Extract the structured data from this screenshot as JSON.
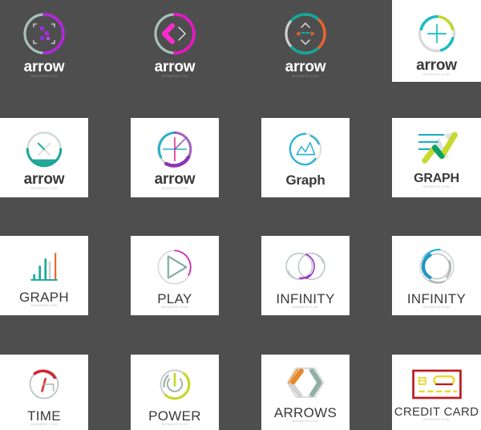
{
  "page": {
    "background_color": "#4e4e4e",
    "panel_color": "#ffffff",
    "columns": 4,
    "rows": 4
  },
  "logos": [
    {
      "id": "arrow-crop-violet",
      "title": "arrow",
      "subtitle": "BUSINESS ICON",
      "tile": "dark",
      "icon": "circle-crop-marks-icon",
      "colors": {
        "accent": "#b324e0",
        "ring": "#a9c0bb",
        "secondary": "#8e2fd4"
      }
    },
    {
      "id": "arrow-chevrons-magenta",
      "title": "arrow",
      "subtitle": "BUSINESS ICON",
      "tile": "dark",
      "icon": "circle-double-chevron-icon",
      "colors": {
        "accent": "#e915c6",
        "ring": "#a9c0bb",
        "secondary": "#ff2bd0"
      }
    },
    {
      "id": "arrow-four-way-teal",
      "title": "arrow",
      "subtitle": "BUSINESS ICON",
      "tile": "dark",
      "icon": "circle-four-direction-arrows-icon",
      "colors": {
        "accent": "#12a89a",
        "ring": "#d0d0d0",
        "secondary": "#e8632a"
      }
    },
    {
      "id": "arrow-plus-lime",
      "title": "arrow",
      "subtitle": "BUSINESS ICON",
      "tile": "white",
      "icon": "circle-plus-icon",
      "colors": {
        "accent": "#13bfc4",
        "ring": "#d8d8d8",
        "secondary": "#c3d92a"
      }
    },
    {
      "id": "arrow-cross-teal",
      "title": "arrow",
      "subtitle": "BUSINESS ICON",
      "tile": "white",
      "icon": "circle-x-cross-icon",
      "colors": {
        "accent": "#17a89b",
        "ring": "#d4dcdb",
        "secondary": "#0f9d90"
      }
    },
    {
      "id": "arrow-crosshair-purple",
      "title": "arrow",
      "subtitle": "BUSINESS ICON",
      "tile": "white",
      "icon": "circle-crosshair-icon",
      "colors": {
        "accent": "#27b0c9",
        "ring": "#d6d6d6",
        "secondary": "#8c36b5"
      }
    },
    {
      "id": "graph-mountain-cyan",
      "title": "Graph",
      "subtitle": "",
      "tile": "white",
      "icon": "circle-mountain-chart-icon",
      "colors": {
        "accent": "#2bb3d4",
        "ring": "#dcdcdc",
        "secondary": "#2bb3d4"
      }
    },
    {
      "id": "graph-zigzag-green",
      "title": "GRAPH",
      "subtitle": "BUSINESS ICON",
      "tile": "white",
      "icon": "zigzag-arrow-lines-icon",
      "colors": {
        "accent": "#0fa36e",
        "ring": "#dedede",
        "secondary": "#c8d92e"
      }
    },
    {
      "id": "graph-bars",
      "title": "GRAPH",
      "subtitle": "BUSINESS ICON",
      "tile": "white",
      "icon": "bar-chart-icon",
      "colors": {
        "accent": "#17a89b",
        "ring": "#cfcfcf",
        "secondary": "#e8632a"
      }
    },
    {
      "id": "play-circle",
      "title": "PLAY",
      "subtitle": "BUSINESS ICON",
      "tile": "white",
      "icon": "circle-play-triangle-icon",
      "colors": {
        "accent": "#7fa89e",
        "ring": "#d8d8d8",
        "secondary": "#d61fb8"
      }
    },
    {
      "id": "infinity-two-rings",
      "title": "INFINITY",
      "subtitle": "BUSINESS ICON",
      "tile": "white",
      "icon": "two-overlapping-circles-icon",
      "colors": {
        "accent": "#9aada8",
        "ring": "#d3d3d3",
        "secondary": "#9b2fc9"
      }
    },
    {
      "id": "infinity-blue-ring",
      "title": "INFINITY",
      "subtitle": "BUSINESS ICON",
      "tile": "white",
      "icon": "segmented-ring-icon",
      "colors": {
        "accent": "#2196c7",
        "ring": "#c9c9c9",
        "secondary": "#1fb6d8"
      }
    },
    {
      "id": "time-clock-g",
      "title": "TIME",
      "subtitle": "BUSINESS ICON",
      "tile": "white",
      "icon": "clock-g-icon",
      "colors": {
        "accent": "#d4242a",
        "ring": "#b7c2bd",
        "secondary": "#e03a3a"
      }
    },
    {
      "id": "power-button",
      "title": "POWER",
      "subtitle": "BUSINESS ICON",
      "tile": "white",
      "icon": "power-button-icon",
      "colors": {
        "accent": "#c3d92a",
        "ring": "#c6cfcb",
        "secondary": "#9bb0a8"
      }
    },
    {
      "id": "arrows-hexagon",
      "title": "ARROWS",
      "subtitle": "BUSINESS ICON",
      "tile": "white",
      "icon": "hexagon-arrows-icon",
      "colors": {
        "accent": "#e8862a",
        "ring": "#d3d3d3",
        "secondary": "#7fa89e"
      }
    },
    {
      "id": "credit-card",
      "title": "CREDIT CARD",
      "subtitle": "BUSINESS ICON",
      "tile": "white",
      "icon": "credit-card-icon",
      "colors": {
        "accent": "#c0181f",
        "ring": "#dcdcdc",
        "secondary": "#e8d82a"
      }
    }
  ]
}
